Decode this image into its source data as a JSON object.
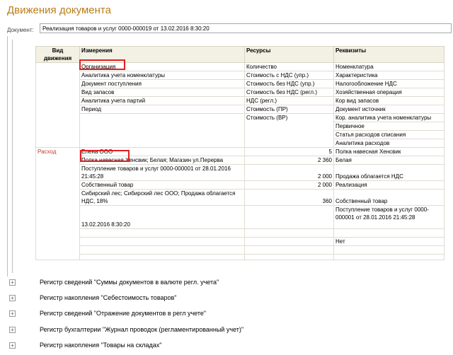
{
  "window": {
    "title": "Движения документа"
  },
  "document": {
    "label": "Документ:",
    "value": "Реализация товаров и услуг 0000-000019 от 13.02.2016 8:30:20"
  },
  "table": {
    "headers": [
      "Вид движения",
      "Измерения",
      "Ресурсы",
      "Реквизиты"
    ],
    "schema_rows": [
      [
        "",
        "Организация",
        "Количество",
        "Номенклатура"
      ],
      [
        "",
        "Аналитика учета номенклатуры",
        "Стоимость с НДС (упр.)",
        "Характеристика"
      ],
      [
        "",
        "Документ поступления",
        "Стоимость без НДС (упр.)",
        "Налогообложение НДС"
      ],
      [
        "",
        "Вид запасов",
        "Стоимость без НДС (регл.)",
        "Хозяйственная операция"
      ],
      [
        "",
        "Аналитика учета партий",
        "НДС (регл.)",
        "Кор вид запасов"
      ],
      [
        "",
        "Период",
        "Стоимость (ПР)",
        "Документ источник"
      ],
      [
        "",
        "",
        "Стоимость (ВР)",
        "Кор. аналитика учета номенклатуры"
      ],
      [
        "",
        "",
        "",
        "Первичное"
      ],
      [
        "",
        "",
        "",
        "Статья расходов списания"
      ],
      [
        "",
        "",
        "",
        "Аналитика расходов"
      ]
    ],
    "data_rows": [
      [
        "Расход",
        "Елена ООО",
        "5",
        "Полка навесная Хенсвик"
      ],
      [
        "",
        "Полка навесная Хенсвик; Белая; Магазин ул.Перерва",
        "2 360",
        "Белая"
      ],
      [
        "",
        "Поступление товаров и услуг 0000-000001 от 28.01.2016 21:45:28",
        "2 000",
        "Продажа облагается НДС"
      ],
      [
        "",
        "Собственный товар",
        "2 000",
        "Реализация"
      ],
      [
        "",
        "Сибирский лес; Сибирский лес ООО; Продажа облагается НДС, 18%",
        "360",
        "Собственный товар"
      ],
      [
        "",
        "13.02.2016 8:30:20",
        "",
        "Поступление товаров и услуг 0000-000001 от 28.01.2016 21:45:28"
      ],
      [
        "",
        "",
        "",
        ""
      ],
      [
        "",
        "",
        "",
        "Нет"
      ],
      [
        "",
        "",
        "",
        ""
      ],
      [
        "",
        "",
        "",
        ""
      ]
    ]
  },
  "registers": [
    "Регистр сведений \"Суммы документов в валюте регл. учета\"",
    "Регистр накопления \"Себестоимость товаров\"",
    "Регистр сведений \"Отражение документов в регл учете\"",
    "Регистр бухгалтерии \"Журнал проводок (регламентированный учет)\"",
    "Регистр накопления \"Товары на складах\""
  ],
  "icons": {
    "expand": "plus-icon"
  },
  "colors": {
    "title": "#b87d1a",
    "header_bg": "#f3f0e4",
    "movement_kind": "#c0392b",
    "highlight": "#e02020"
  }
}
